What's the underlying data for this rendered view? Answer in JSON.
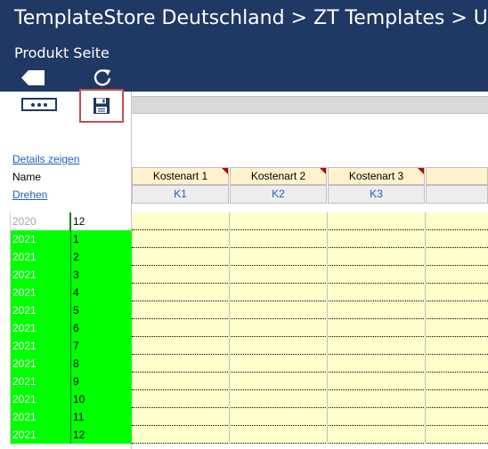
{
  "header": {
    "title": "TemplateStore Deutschland > ZT  Templates > U",
    "subtitle": "Produkt Seite",
    "background": "#1f3864"
  },
  "nav": {
    "back_icon": "back-arrow-icon",
    "refresh_icon": "refresh-icon"
  },
  "toolbar": {
    "more_icon": "more-dots-icon",
    "save_icon": "floppy-save-icon",
    "save_highlight_color": "#c0504d"
  },
  "left": {
    "details_link": "Details zeigen",
    "name_label": "Name",
    "rotate_link": "Drehen"
  },
  "columns": [
    {
      "label": "Kostenart 1",
      "code": "K1"
    },
    {
      "label": "Kostenart 2",
      "code": "K2"
    },
    {
      "label": "Kostenart 3",
      "code": "K3"
    }
  ],
  "rows": [
    {
      "year": "2020",
      "month": "12"
    },
    {
      "year": "2021",
      "month": "1"
    },
    {
      "year": "2021",
      "month": "2"
    },
    {
      "year": "2021",
      "month": "3"
    },
    {
      "year": "2021",
      "month": "4"
    },
    {
      "year": "2021",
      "month": "5"
    },
    {
      "year": "2021",
      "month": "6"
    },
    {
      "year": "2021",
      "month": "7"
    },
    {
      "year": "2021",
      "month": "8"
    },
    {
      "year": "2021",
      "month": "9"
    },
    {
      "year": "2021",
      "month": "10"
    },
    {
      "year": "2021",
      "month": "11"
    },
    {
      "year": "2021",
      "month": "12"
    }
  ],
  "colors": {
    "active_period": "#00ff00",
    "input_cell": "#ffffcc",
    "column_header": "#fff2cc",
    "link": "#1f5fbf"
  }
}
